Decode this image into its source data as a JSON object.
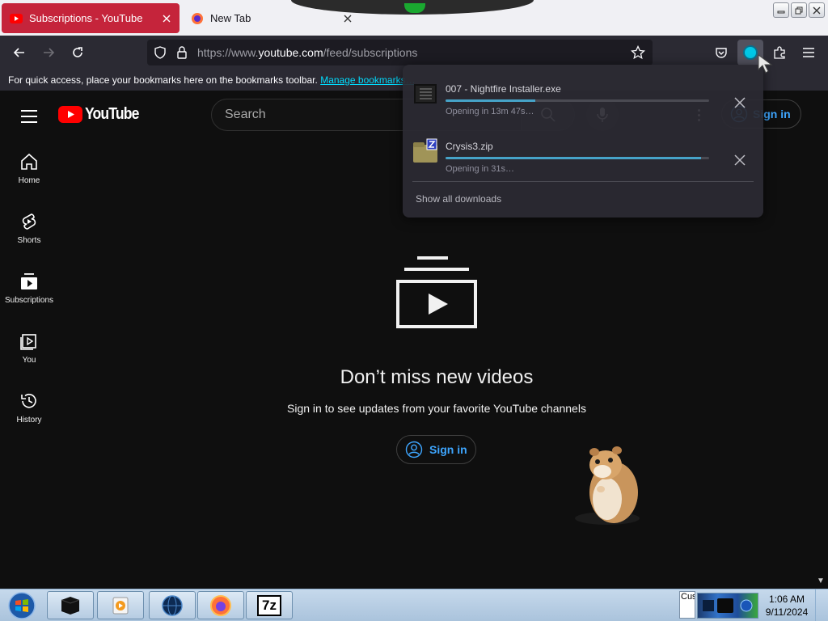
{
  "browser": {
    "tabs": [
      {
        "title": "Subscriptions - YouTube",
        "active": true
      },
      {
        "title": "New Tab",
        "active": false
      }
    ],
    "url": {
      "scheme": "https://www.",
      "host": "youtube.com",
      "path": "/feed/subscriptions"
    },
    "bookmarks_bar": {
      "message": "For quick access, place your bookmarks here on the bookmarks toolbar.",
      "link": "Manage bookmarks…"
    }
  },
  "youtube": {
    "logo_text": "YouTube",
    "search_placeholder": "Search",
    "sign_in_label": "Sign in",
    "guide": [
      {
        "label": "Home",
        "icon": "home-icon"
      },
      {
        "label": "Shorts",
        "icon": "shorts-icon"
      },
      {
        "label": "Subscriptions",
        "icon": "subscriptions-icon"
      },
      {
        "label": "You",
        "icon": "you-icon"
      },
      {
        "label": "History",
        "icon": "history-icon"
      }
    ],
    "empty_state": {
      "title": "Don’t miss new videos",
      "subtitle": "Sign in to see updates from your favorite YouTube channels",
      "button": "Sign in"
    }
  },
  "downloads": {
    "items": [
      {
        "name": "007 - Nightfire Installer.exe",
        "status": "Opening in 13m 47s…",
        "progress": 0.34
      },
      {
        "name": "Crysis3.zip",
        "status": "Opening in 31s…",
        "progress": 0.97
      }
    ],
    "show_all": "Show all downloads"
  },
  "taskbar": {
    "tray_text": "Cus",
    "time": "1:06 AM",
    "date": "9/11/2024",
    "seven_zip_label": "7z"
  },
  "colors": {
    "yt_red": "#ff0000",
    "yt_link_blue": "#3ea6ff",
    "firefox_dark": "#2b2a33",
    "active_tab": "#c5243b",
    "download_progress": "#46a3c8"
  }
}
